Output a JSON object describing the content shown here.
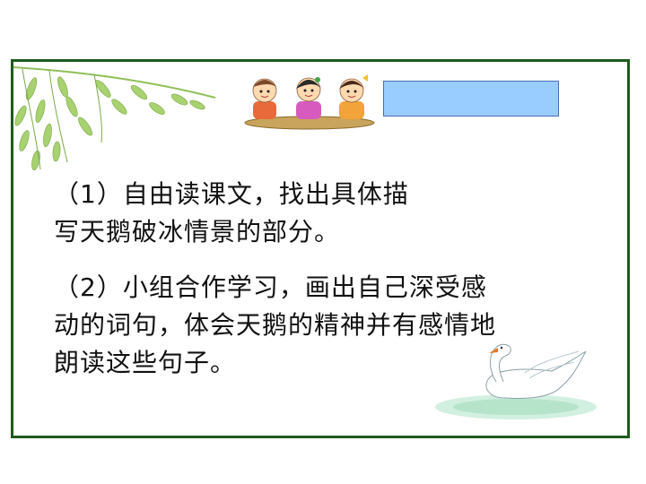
{
  "task1": {
    "line1": "（1）自由读课文，找出具体描",
    "line2": "写天鹅破冰情景的部分。"
  },
  "task2": {
    "line1": "（2）小组合作学习，画出自己深受感",
    "line2": "动的词句，体会天鹅的精神并有感情地",
    "line3": "朗读这些句子。"
  },
  "colors": {
    "frame_border": "#1e5a1e",
    "blue_box": "#99ccff",
    "text": "#111111"
  },
  "icons": [
    "willow-branch-icon",
    "children-group-icon",
    "swan-icon"
  ]
}
